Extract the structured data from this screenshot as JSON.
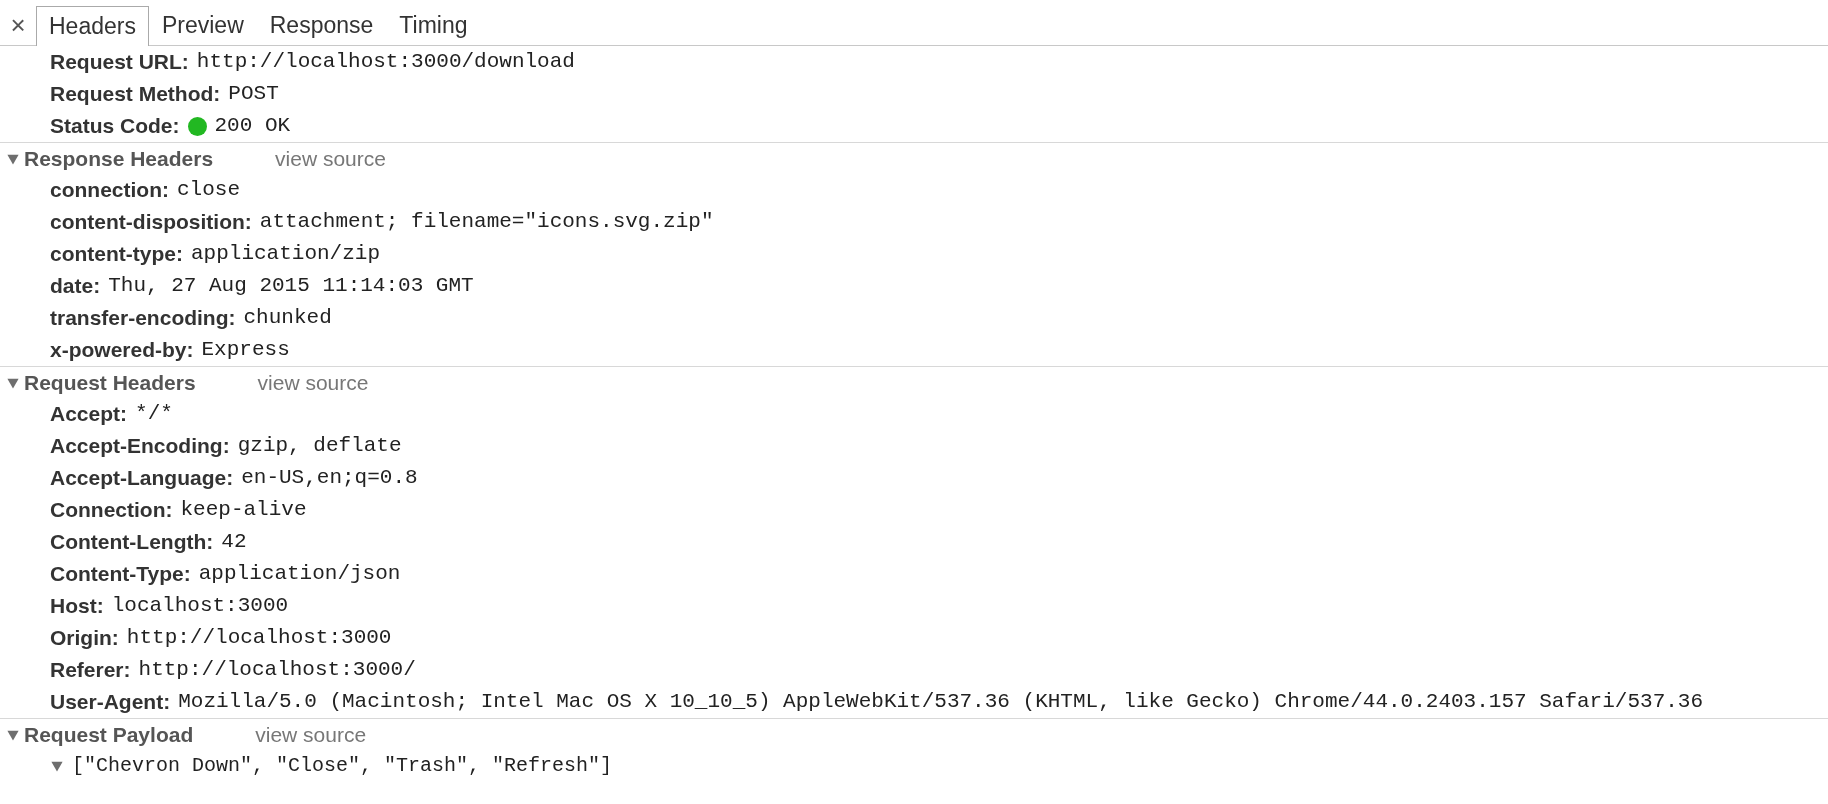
{
  "close_button": "×",
  "tabs": [
    {
      "label": "Headers",
      "selected": true
    },
    {
      "label": "Preview",
      "selected": false
    },
    {
      "label": "Response",
      "selected": false
    },
    {
      "label": "Timing",
      "selected": false
    }
  ],
  "general": [
    {
      "name": "Request URL:",
      "value": "http://localhost:3000/download"
    },
    {
      "name": "Request Method:",
      "value": "POST"
    },
    {
      "name": "Status Code:",
      "value": "200 OK",
      "status_ok": true
    }
  ],
  "sections": [
    {
      "title": "Response Headers",
      "expanded": true,
      "link": "view source",
      "headers": [
        {
          "name": "connection:",
          "value": "close"
        },
        {
          "name": "content-disposition:",
          "value": "attachment; filename=\"icons.svg.zip\""
        },
        {
          "name": "content-type:",
          "value": "application/zip"
        },
        {
          "name": "date:",
          "value": "Thu, 27 Aug 2015 11:14:03 GMT"
        },
        {
          "name": "transfer-encoding:",
          "value": "chunked"
        },
        {
          "name": "x-powered-by:",
          "value": "Express"
        }
      ]
    },
    {
      "title": "Request Headers",
      "expanded": true,
      "link": "view source",
      "headers": [
        {
          "name": "Accept:",
          "value": "*/*"
        },
        {
          "name": "Accept-Encoding:",
          "value": "gzip, deflate"
        },
        {
          "name": "Accept-Language:",
          "value": "en-US,en;q=0.8"
        },
        {
          "name": "Connection:",
          "value": "keep-alive"
        },
        {
          "name": "Content-Length:",
          "value": "42"
        },
        {
          "name": "Content-Type:",
          "value": "application/json"
        },
        {
          "name": "Host:",
          "value": "localhost:3000"
        },
        {
          "name": "Origin:",
          "value": "http://localhost:3000"
        },
        {
          "name": "Referer:",
          "value": "http://localhost:3000/"
        },
        {
          "name": "User-Agent:",
          "value": "Mozilla/5.0 (Macintosh; Intel Mac OS X 10_10_5) AppleWebKit/537.36 (KHTML, like Gecko) Chrome/44.0.2403.157 Safari/537.36"
        }
      ]
    },
    {
      "title": "Request Payload",
      "expanded": true,
      "link": "view source",
      "payload": {
        "text": "[\"Chevron Down\", \"Close\", \"Trash\", \"Refresh\"]",
        "expanded": true
      }
    }
  ]
}
